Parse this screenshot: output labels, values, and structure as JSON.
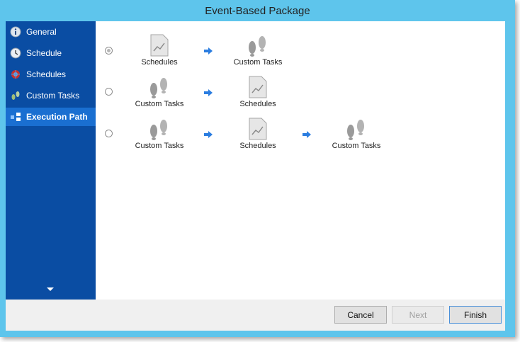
{
  "window": {
    "title": "Event-Based Package"
  },
  "sidebar": {
    "items": [
      {
        "label": "General",
        "icon": "info-icon"
      },
      {
        "label": "Schedule",
        "icon": "clock-icon"
      },
      {
        "label": "Schedules",
        "icon": "schedules-icon"
      },
      {
        "label": "Custom Tasks",
        "icon": "custom-tasks-icon"
      },
      {
        "label": "Execution Path",
        "icon": "execution-path-icon",
        "active": true
      }
    ]
  },
  "paths": {
    "row1": {
      "selected": true,
      "step1": "Schedules",
      "step2": "Custom Tasks"
    },
    "row2": {
      "selected": false,
      "step1": "Custom Tasks",
      "step2": "Schedules"
    },
    "row3": {
      "selected": false,
      "step1": "Custom Tasks",
      "step2": "Schedules",
      "step3": "Custom Tasks"
    }
  },
  "footer": {
    "cancel": "Cancel",
    "next": "Next",
    "finish": "Finish"
  },
  "colors": {
    "titlebar": "#5ec5ec",
    "sidebar": "#0a4da3",
    "active_item": "#1a6fd1",
    "arrow": "#2b7de0"
  }
}
